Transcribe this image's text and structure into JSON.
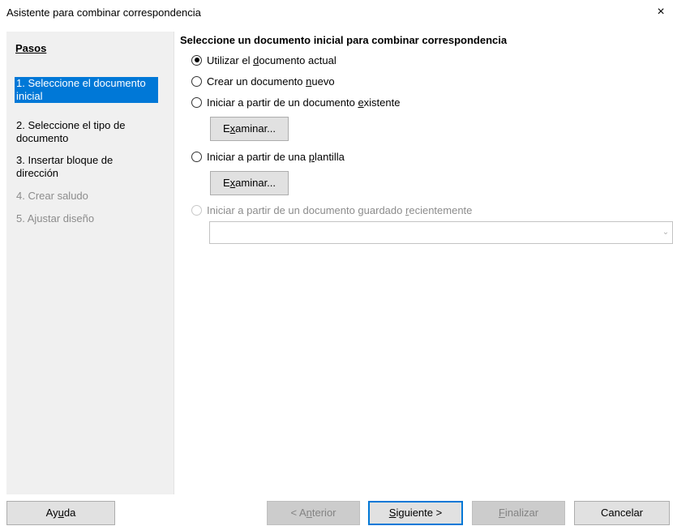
{
  "window": {
    "title": "Asistente para combinar correspondencia",
    "close_glyph": "×"
  },
  "sidebar": {
    "heading": "Pasos",
    "steps": [
      {
        "line1": "1. Seleccione el documento",
        "line2": "inicial",
        "state": "selected"
      },
      {
        "line1": "2. Seleccione el tipo de",
        "line2": "documento",
        "state": "enabled"
      },
      {
        "line1": "3. Insertar bloque de",
        "line2": "dirección",
        "state": "enabled"
      },
      {
        "line1": "4. Crear saludo",
        "line2": "",
        "state": "disabled"
      },
      {
        "line1": "5. Ajustar diseño",
        "line2": "",
        "state": "disabled"
      }
    ]
  },
  "main": {
    "heading": "Seleccione un documento inicial para combinar correspondencia",
    "options": {
      "current": {
        "pre": "Utilizar el ",
        "key": "d",
        "post": "ocumento actual",
        "checked": true
      },
      "new": {
        "pre": "Crear un documento ",
        "key": "n",
        "post": "uevo",
        "checked": false
      },
      "existing": {
        "pre": "Iniciar a partir de un documento ",
        "key": "e",
        "post": "xistente",
        "checked": false
      },
      "template": {
        "pre": "Iniciar a partir de una ",
        "key": "p",
        "post": "lantilla",
        "checked": false
      },
      "recent": {
        "pre": "Iniciar a partir de un documento guardado ",
        "key": "r",
        "post": "ecientemente",
        "checked": false,
        "disabled": true
      }
    },
    "browse_button": {
      "pre": "E",
      "key": "x",
      "post": "aminar..."
    },
    "recent_combo": {
      "value": ""
    }
  },
  "footer": {
    "help": {
      "pre": "Ay",
      "key": "u",
      "post": "da"
    },
    "back": {
      "pre": "< A",
      "key": "n",
      "post": "terior"
    },
    "next": {
      "pre": "",
      "key": "S",
      "post": "iguiente >"
    },
    "finish": {
      "pre": "",
      "key": "F",
      "post": "inalizar"
    },
    "cancel": {
      "label": "Cancelar"
    }
  },
  "colors": {
    "selection": "#0078d7",
    "disabled_text": "#8c8c8c",
    "sidebar_bg": "#f0f0f0",
    "button_bg": "#e1e1e1"
  }
}
